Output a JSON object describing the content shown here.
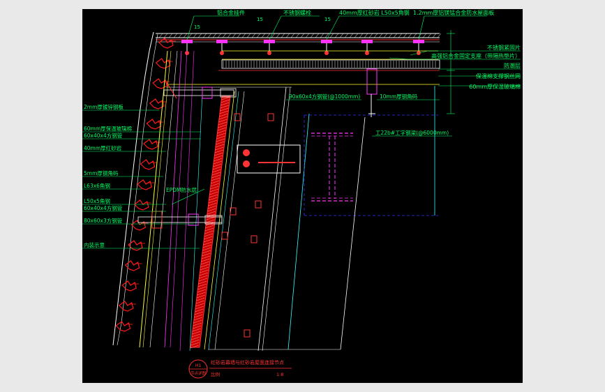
{
  "colors": {
    "background": "#000000",
    "frame": "#e9e9e9",
    "annotation": "#00ff66",
    "section_red": "#ff1a1a",
    "insulation_yellow": "#ffff33",
    "mullion_cyan": "#33ffff",
    "steel_magenta": "#ff33ff",
    "panel_white": "#ffffff",
    "hidden_blue": "#3333ff"
  },
  "top_labels": {
    "aluminum_fitting": "铝合金挂件",
    "stainless_bolt": "不锈钢螺栓",
    "sandstone_angle": "40mm厚红砂岩  L50x5角钢",
    "roof_panel": "1.2mm厚铝镁锰合金防水屋面板"
  },
  "right_labels": {
    "stainless_cap": "不锈钢紧固片",
    "bracket": "高强铝合金固定支座（带隔热垫片）",
    "membrane": "防潮层",
    "mesh": "保温棉支撑钢丝网",
    "insulation_top": "60mm厚保温玻璃棉"
  },
  "inner_labels": {
    "square_tube_top": "90x60x4方钢管(@1000mm)",
    "angle_plate": "10mm厚钢角码",
    "i_beam": "工22b#工字钢梁(@6000mm)",
    "waterproof": "EPDM防水层"
  },
  "left_labels": {
    "galv_plate": "2mm厚镀锌钢板",
    "insulation": "60mm厚保温玻璃棉",
    "tube_60x40": "60x40x4方钢管",
    "sandstone": "40mm厚红砂岩",
    "angle_code": "5mm厚钢角码",
    "l63": "L63x6角钢",
    "l50": "L50x5角钢",
    "tube_60x40b": "60x40x4方钢管",
    "tube_80x60": "80x60x3方钢管",
    "interior": "内装示意"
  },
  "dimensions": {
    "d1": "15",
    "d2": "15",
    "d3": "15"
  },
  "title_block": {
    "symbol_top": "H1",
    "symbol_bottom": "节点详图",
    "title": "红砂岩幕墙与红砂岩屋面连接节点",
    "scale_label": "比例",
    "scale": "1:8"
  }
}
